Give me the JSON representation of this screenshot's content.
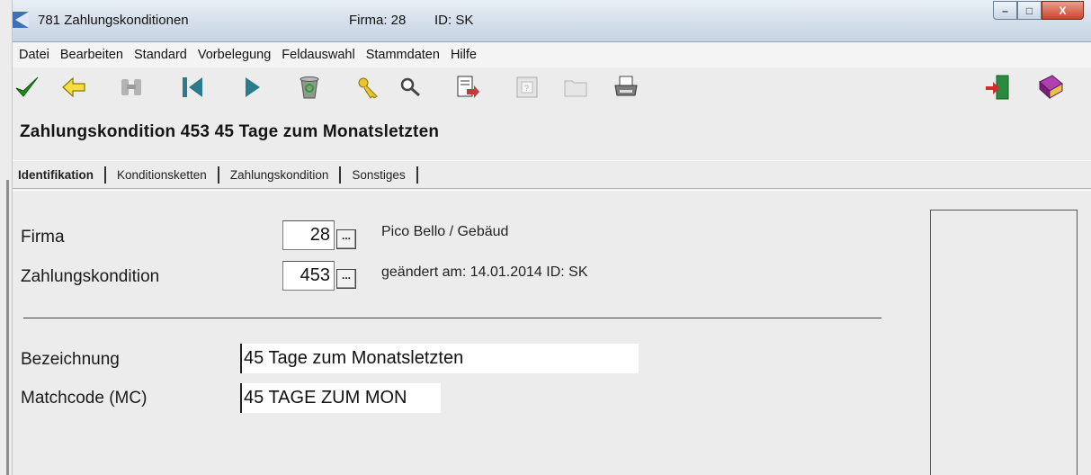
{
  "window": {
    "title": "781 Zahlungskonditionen",
    "firma": "Firma:  28",
    "id": "ID: SK",
    "min_label": "–",
    "max_label": "□",
    "close_label": "X"
  },
  "menu": [
    "Datei",
    "Bearbeiten",
    "Standard",
    "Vorbelegung",
    "Feldauswahl",
    "Stammdaten",
    "Hilfe"
  ],
  "toolbar": {
    "icons": [
      "check-icon",
      "back-arrow-icon",
      "binoculars-icon",
      "first-record-icon",
      "next-record-icon",
      "recycle-bin-icon",
      "key-icon",
      "search-icon",
      "export-icon",
      "help-doc-icon",
      "folder-icon",
      "printer-icon",
      "exit-door-icon",
      "book-icon"
    ]
  },
  "heading": "Zahlungskondition 453  45 Tage zum Monatsletzten",
  "tabs": [
    "Identifikation",
    "Konditionsketten",
    "Zahlungskondition",
    "Sonstiges"
  ],
  "form": {
    "firma_label": "Firma",
    "firma_value": "28",
    "firma_button": "...",
    "firma_info": "Pico Bello  / Gebäud",
    "zk_label": "Zahlungskondition",
    "zk_value": "453",
    "zk_button": "...",
    "zk_info": "geändert am: 14.01.2014 ID: SK",
    "bez_label": "Bezeichnung",
    "bez_value": "45 Tage zum Monatsletzten",
    "mc_label": "Matchcode (MC)",
    "mc_value": "45 TAGE ZUM MON"
  }
}
